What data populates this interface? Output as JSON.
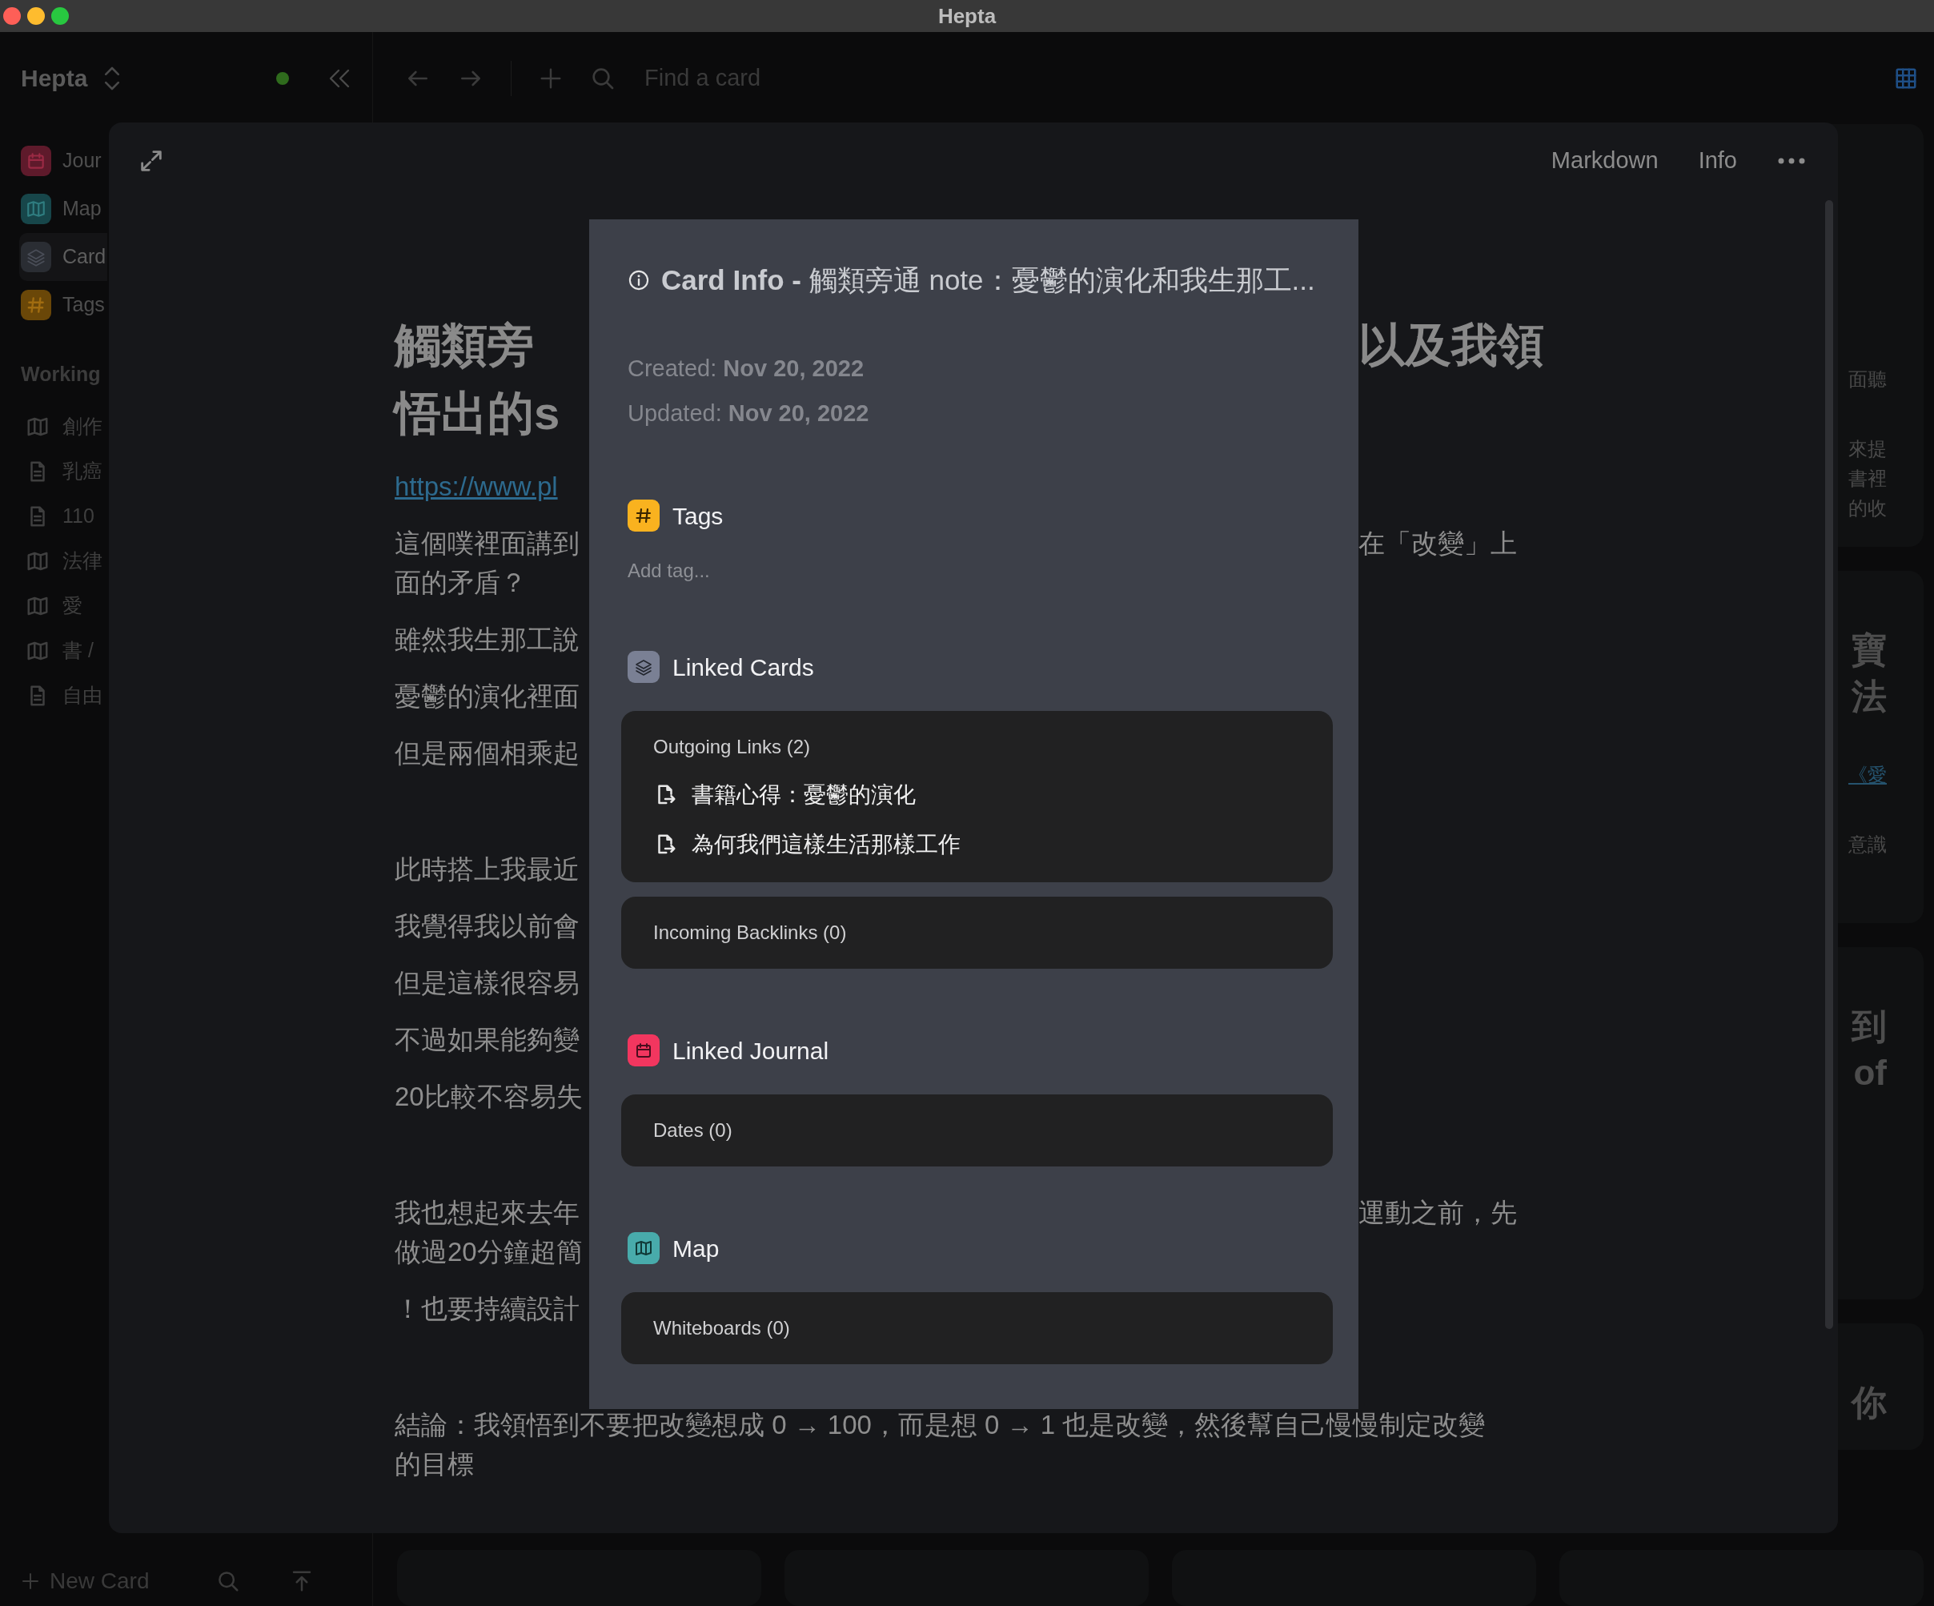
{
  "window": {
    "title": "Hepta"
  },
  "sidebar": {
    "workspace": "Hepta",
    "nav": [
      {
        "label": "Jour",
        "kind": "journal",
        "selected": false
      },
      {
        "label": "Map",
        "kind": "map",
        "selected": false
      },
      {
        "label": "Card",
        "kind": "card",
        "selected": true
      },
      {
        "label": "Tags",
        "kind": "tags",
        "selected": false
      }
    ],
    "section": "Working",
    "tree": [
      {
        "label": "創作",
        "kind": "map"
      },
      {
        "label": "乳癌",
        "kind": "doc"
      },
      {
        "label": "110",
        "kind": "doc"
      },
      {
        "label": "法律",
        "kind": "map"
      },
      {
        "label": "愛",
        "kind": "map"
      },
      {
        "label": "書 /",
        "kind": "map"
      },
      {
        "label": "自由",
        "kind": "doc"
      }
    ],
    "new_card": "New Card"
  },
  "toolbar": {
    "search": {
      "placeholder": "Find a card"
    }
  },
  "background_cards": [
    {
      "blocks": [
        {
          "kind": "text",
          "lines": [
            "面聽"
          ]
        },
        {
          "kind": "text",
          "lines": [
            "來提",
            "書裡",
            "的收"
          ]
        }
      ]
    },
    {
      "blocks": [
        {
          "kind": "heading",
          "lines": [
            "寶",
            "法"
          ]
        },
        {
          "kind": "link",
          "lines": [
            "《愛"
          ]
        },
        {
          "kind": "text",
          "lines": [
            "意識"
          ]
        }
      ]
    },
    {
      "blocks": [
        {
          "kind": "heading",
          "lines": [
            "到",
            "of"
          ]
        }
      ]
    },
    {
      "blocks": [
        {
          "kind": "heading",
          "lines": [
            "你"
          ]
        }
      ]
    }
  ],
  "card": {
    "actions": [
      "Markdown",
      "Info"
    ],
    "sections": [
      [
        {
          "kind": "title",
          "lines": [
            {
              "left": "觸類旁",
              "right": "以及我領"
            },
            {
              "left": "悟出的s"
            }
          ]
        },
        {
          "kind": "link",
          "lines": [
            {
              "left": "https://www.pl"
            }
          ]
        },
        {
          "kind": "text",
          "lines": [
            {
              "left": "這個噗裡面講到",
              "right": "在「改變」上"
            },
            {
              "left": "面的矛盾？"
            }
          ]
        },
        {
          "kind": "text",
          "lines": [
            {
              "left": "雖然我生那工說"
            }
          ]
        },
        {
          "kind": "text",
          "lines": [
            {
              "left": "憂鬱的演化裡面"
            }
          ]
        },
        {
          "kind": "text",
          "lines": [
            {
              "left": "但是兩個相乘起"
            }
          ]
        }
      ],
      [
        {
          "kind": "text",
          "lines": [
            {
              "left": "此時搭上我最近"
            }
          ]
        },
        {
          "kind": "text",
          "lines": [
            {
              "left": "我覺得我以前會"
            }
          ]
        },
        {
          "kind": "text",
          "lines": [
            {
              "left": "但是這樣很容易"
            }
          ]
        },
        {
          "kind": "text",
          "lines": [
            {
              "left": "不過如果能夠變"
            }
          ]
        },
        {
          "kind": "text",
          "lines": [
            {
              "left": "20比較不容易失"
            }
          ]
        }
      ],
      [
        {
          "kind": "text",
          "lines": [
            {
              "left": "我也想起來去年",
              "right": "運動之前，先"
            },
            {
              "left": "做過20分鐘超簡"
            }
          ]
        },
        {
          "kind": "text",
          "lines": [
            {
              "left": "！也要持續設計"
            }
          ]
        }
      ],
      [
        {
          "kind": "text",
          "lines": [
            {
              "left": "結論：我領悟到不要把改變想成 0 → 100，而是想 0 → 1 也是改變，然後幫自己慢慢制定改變"
            },
            {
              "left": "的目標"
            }
          ]
        }
      ]
    ]
  },
  "info_dialog": {
    "title": "**Card Info -** 觸類旁通 note：憂鬱的演化和我生那工...",
    "dates": [
      "Created: **Nov 20, 2022**",
      "Updated: **Nov 20, 2022**"
    ],
    "sections": [
      {
        "kind": "tags",
        "heading": "Tags",
        "placeholder": "Add tag..."
      },
      {
        "kind": "cards",
        "heading": "Linked Cards",
        "groups": [
          {
            "title": "Outgoing Links (2)",
            "items": [
              "書籍心得：憂鬱的演化",
              "為何我們這樣生活那樣工作"
            ]
          },
          {
            "title": "Incoming Backlinks (0)"
          }
        ]
      },
      {
        "kind": "journal",
        "heading": "Linked Journal",
        "groups": [
          {
            "title": "Dates (0)"
          }
        ]
      },
      {
        "kind": "map",
        "heading": "Map",
        "groups": [
          {
            "title": "Whiteboards (0)"
          }
        ]
      }
    ]
  }
}
